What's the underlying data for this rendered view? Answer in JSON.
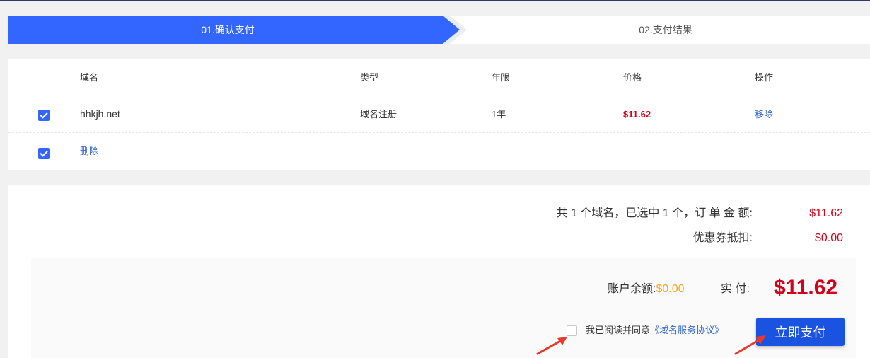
{
  "steps": [
    {
      "label": "01.确认支付",
      "active": true
    },
    {
      "label": "02.支付结果",
      "active": false
    }
  ],
  "table": {
    "headers": {
      "domain": "域名",
      "type": "类型",
      "years": "年限",
      "price": "价格",
      "action": "操作"
    },
    "rows": [
      {
        "checked": true,
        "domain": "hhkjh.net",
        "type": "域名注册",
        "years": "1年",
        "price": "$11.62",
        "action": "移除"
      }
    ],
    "footer": {
      "checked": true,
      "delete_label": "删除"
    }
  },
  "summary": {
    "order_label": "共 1 个域名，已选中 1 个，订 单 金 额:",
    "order_value": "$11.62",
    "coupon_label": "优惠券抵扣:",
    "coupon_value": "$0.00",
    "balance_label": "账户余额:",
    "balance_value": "$0.00",
    "actual_label": "实 付:",
    "actual_value": "$11.62",
    "agree_text": "我已阅读并同意",
    "agree_link": "《域名服务协议》",
    "pay_button": "立即支付"
  },
  "colors": {
    "accent": "#3366ff",
    "price": "#d0021b",
    "balance": "#f5a623",
    "annotation_arrow": "#e8392c"
  }
}
